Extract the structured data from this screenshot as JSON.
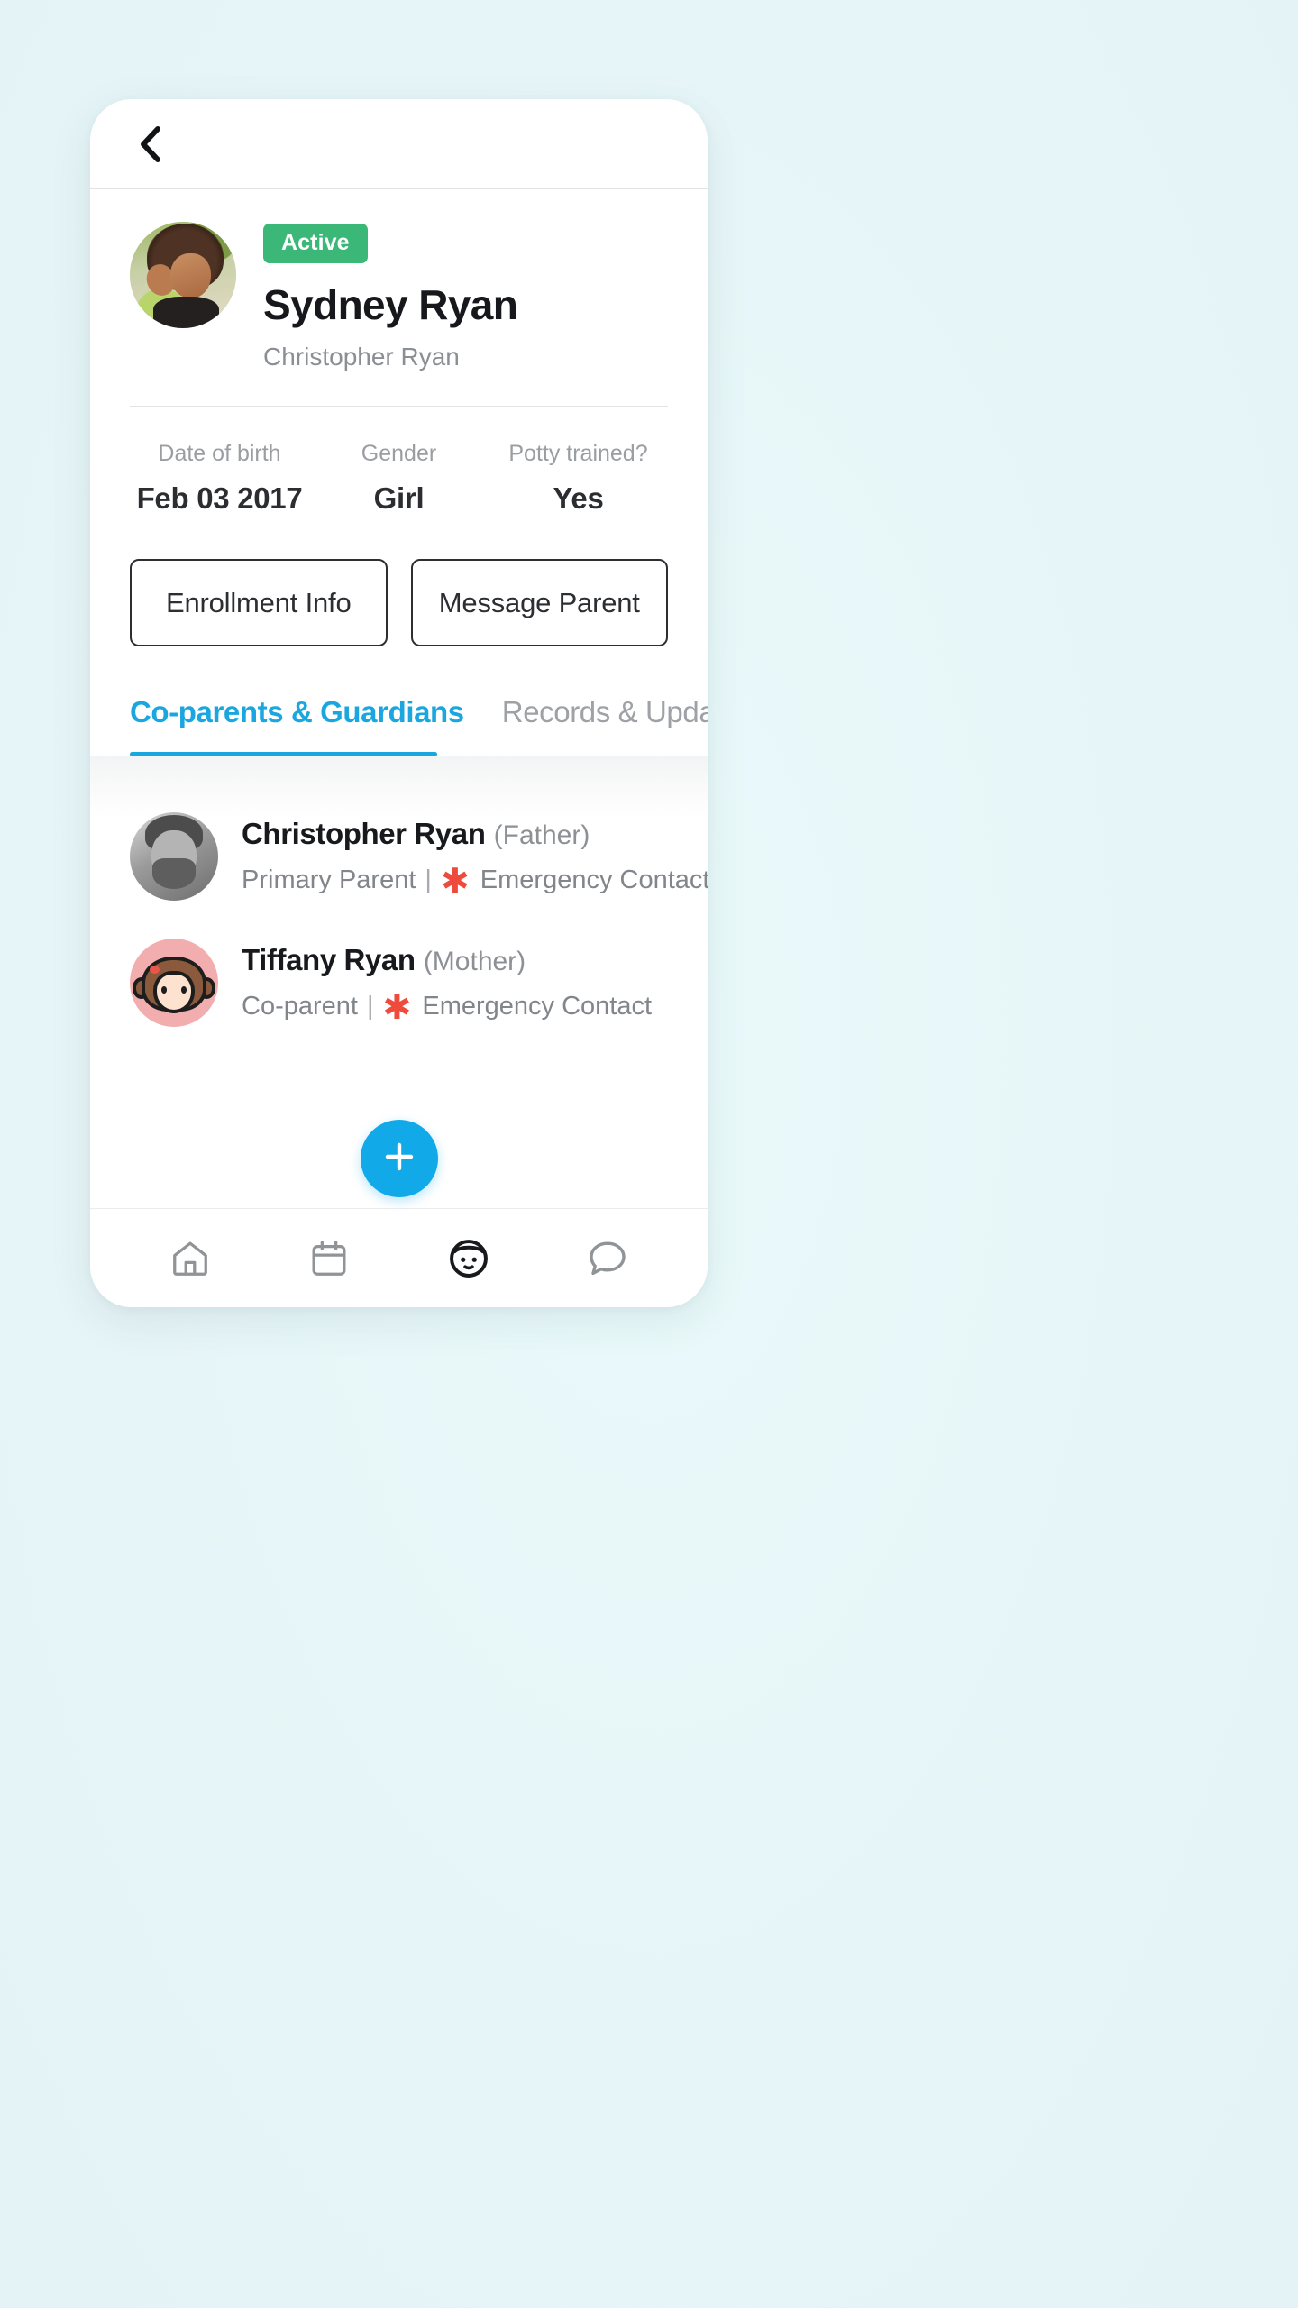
{
  "header": {
    "back_icon": "chevron-left-icon"
  },
  "profile": {
    "status_badge": "Active",
    "child_name": "Sydney Ryan",
    "parent_name": "Christopher Ryan",
    "avatar_icon": "child-photo-avatar",
    "badge_color": "#3bb878"
  },
  "stats": [
    {
      "label": "Date of birth",
      "value": "Feb 03 2017"
    },
    {
      "label": "Gender",
      "value": "Girl"
    },
    {
      "label": "Potty trained?",
      "value": "Yes"
    }
  ],
  "actions": {
    "enrollment_label": "Enrollment Info",
    "message_label": "Message Parent"
  },
  "tabs": [
    {
      "label": "Co-parents & Guardians",
      "active": true
    },
    {
      "label": "Records & Updates",
      "active": false
    }
  ],
  "tab_accent_color": "#1aa7e0",
  "guardians": [
    {
      "name": "Christopher Ryan",
      "relation": "(Father)",
      "role": "Primary Parent",
      "separator": "|",
      "emergency_icon": "asterisk-icon",
      "emergency_label": "Emergency Contact",
      "avatar_icon": "father-photo-avatar"
    },
    {
      "name": "Tiffany Ryan",
      "relation": "(Mother)",
      "role": "Co-parent",
      "separator": "|",
      "emergency_icon": "asterisk-icon",
      "emergency_label": "Emergency Contact",
      "avatar_icon": "mother-cartoon-avatar"
    }
  ],
  "emergency_color": "#ef4b3c",
  "fab": {
    "icon": "plus-icon",
    "color": "#11a9e8"
  },
  "bottom_nav": [
    {
      "icon": "home-icon",
      "active": false
    },
    {
      "icon": "calendar-icon",
      "active": false
    },
    {
      "icon": "child-face-icon",
      "active": true
    },
    {
      "icon": "chat-bubble-icon",
      "active": false
    }
  ]
}
